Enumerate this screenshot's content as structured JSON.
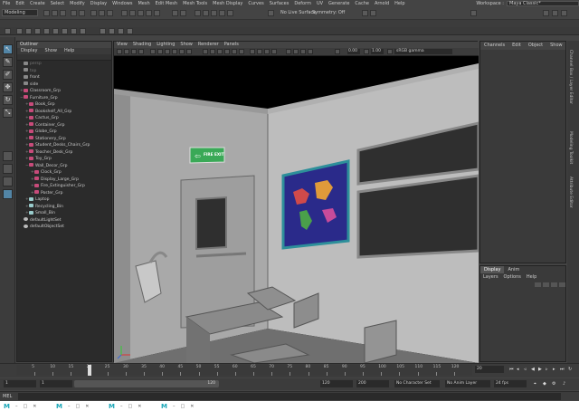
{
  "menu": [
    "File",
    "Edit",
    "Create",
    "Select",
    "Modify",
    "Display",
    "Windows",
    "Mesh",
    "Edit Mesh",
    "Mesh Tools",
    "Mesh Display",
    "Curves",
    "Surfaces",
    "Deform",
    "UV",
    "Generate",
    "Cache",
    "Arnold",
    "Help"
  ],
  "workspace": {
    "label": "Workspace :",
    "value": "Maya Classic*"
  },
  "status": {
    "mode": "Modeling",
    "no_live_surface": "No Live Surface",
    "symmetry": "Symmetry: Off"
  },
  "outliner": {
    "title": "Outliner",
    "menu": [
      "Display",
      "Show",
      "Help"
    ],
    "rows": [
      {
        "label": "persp",
        "level": 0,
        "icon": "camera-icon",
        "dim": true
      },
      {
        "label": "top",
        "level": 0,
        "icon": "camera-icon",
        "dim": true
      },
      {
        "label": "front",
        "level": 0,
        "icon": "camera-icon",
        "dim": false
      },
      {
        "label": "side",
        "level": 0,
        "icon": "camera-icon",
        "dim": false
      },
      {
        "label": "Classroom_Grp",
        "level": 0,
        "icon": "group-icon",
        "exp": "+"
      },
      {
        "label": "Furniture_Grp",
        "level": 0,
        "icon": "group-icon",
        "exp": "−"
      },
      {
        "label": "Book_Grp",
        "level": 1,
        "icon": "group-icon",
        "exp": "+"
      },
      {
        "label": "Bookshelf_All_Grp",
        "level": 1,
        "icon": "group-icon",
        "exp": "+"
      },
      {
        "label": "Cactus_Grp",
        "level": 1,
        "icon": "group-icon",
        "exp": "+"
      },
      {
        "label": "Container_Grp",
        "level": 1,
        "icon": "group-icon",
        "exp": "+"
      },
      {
        "label": "Globe_Grp",
        "level": 1,
        "icon": "group-icon",
        "exp": "+"
      },
      {
        "label": "Stationery_Grp",
        "level": 1,
        "icon": "group-icon",
        "exp": "+"
      },
      {
        "label": "Student_Desks_Chairs_Grp",
        "level": 1,
        "icon": "group-icon",
        "exp": "+"
      },
      {
        "label": "Teacher_Desk_Grp",
        "level": 1,
        "icon": "group-icon",
        "exp": "+"
      },
      {
        "label": "Toy_Grp",
        "level": 1,
        "icon": "group-icon",
        "exp": "+"
      },
      {
        "label": "Wall_Decor_Grp",
        "level": 1,
        "icon": "group-icon",
        "exp": "−"
      },
      {
        "label": "Clock_Grp",
        "level": 2,
        "icon": "group-icon",
        "exp": "+"
      },
      {
        "label": "Display_Large_Grp",
        "level": 2,
        "icon": "group-icon",
        "exp": "+"
      },
      {
        "label": "Fire_Extinguisher_Grp",
        "level": 2,
        "icon": "group-icon",
        "exp": "+"
      },
      {
        "label": "Poster_Grp",
        "level": 2,
        "icon": "group-icon",
        "exp": "+"
      },
      {
        "label": "Laptop",
        "level": 1,
        "icon": "locator-icon",
        "exp": "+"
      },
      {
        "label": "Recycling_Bin",
        "level": 1,
        "icon": "locator-icon",
        "exp": "+"
      },
      {
        "label": "Small_Bin",
        "level": 1,
        "icon": "locator-icon",
        "exp": "+"
      },
      {
        "label": "defaultLightSet",
        "level": 0,
        "icon": "light-set-icon"
      },
      {
        "label": "defaultObjectSet",
        "level": 0,
        "icon": "light-set-icon"
      }
    ]
  },
  "viewport": {
    "menu": [
      "View",
      "Shading",
      "Lighting",
      "Show",
      "Renderer",
      "Panels"
    ],
    "field1": "0.00",
    "field2": "1.00",
    "color_space": "sRGB gamma",
    "sign_text": "FIRE EXIT",
    "sign_color": "#3aa957"
  },
  "channelbox": {
    "menu": [
      "Channels",
      "Edit",
      "Object",
      "Show"
    ]
  },
  "layers": {
    "tabs": [
      "Display",
      "Anim"
    ],
    "menu": [
      "Layers",
      "Options",
      "Help"
    ]
  },
  "side_tabs": [
    "Channel Box / Layer Editor",
    "Modeling Toolkit",
    "Attribute Editor"
  ],
  "timeline": {
    "ticks": [
      "5",
      "10",
      "15",
      "20",
      "25",
      "30",
      "35",
      "40",
      "45",
      "50",
      "55",
      "60",
      "65",
      "70",
      "75",
      "80",
      "85",
      "90",
      "95",
      "100",
      "105",
      "110",
      "115",
      "120"
    ],
    "current": "20",
    "frame_field": "20"
  },
  "range": {
    "start": "1",
    "start2": "1",
    "bar_value": "120",
    "end": "120",
    "end2": "200",
    "character_set": "No Character Set",
    "anim_layer": "No Anim Layer",
    "fps": "24 fps"
  },
  "command": {
    "label": "MEL"
  },
  "taskbar": {
    "items": [
      {
        "logo": "M"
      },
      {
        "logo": "M"
      },
      {
        "logo": "M"
      },
      {
        "logo": "M"
      }
    ]
  },
  "colors": {
    "accent": "#5285a6",
    "maya_logo": "#1aa6b7"
  }
}
